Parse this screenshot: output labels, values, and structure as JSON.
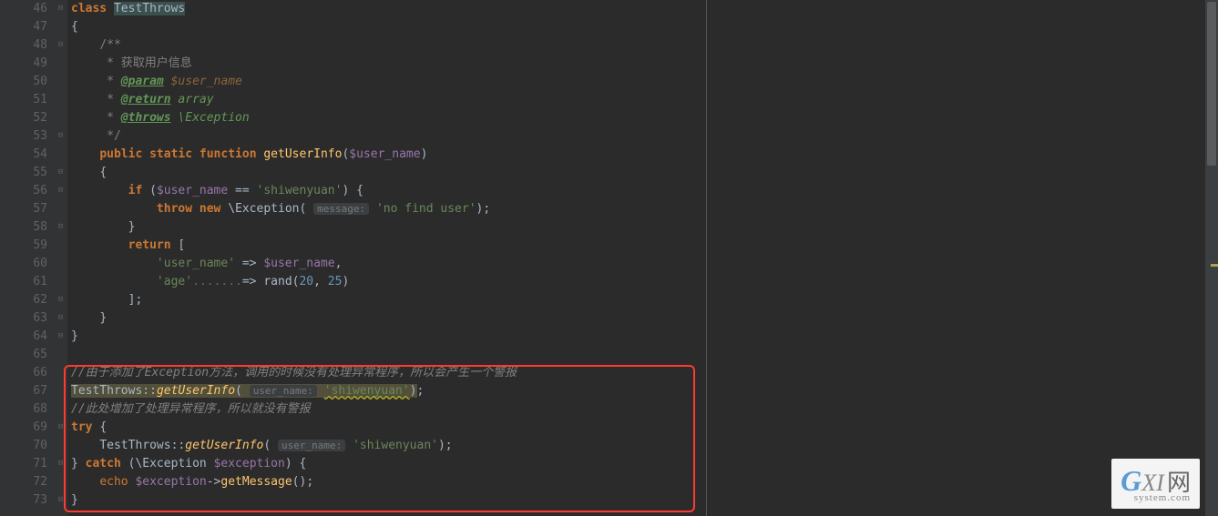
{
  "lines": {
    "start": 46,
    "end": 73
  },
  "code": {
    "l46_class": "class",
    "l46_name": "TestThrows",
    "l47_brace": "{",
    "l48_doc": "/**",
    "l49_doc": " * 获取用户信息",
    "l50_tag": "@param",
    "l50_var": "$user_name",
    "l51_tag": "@return",
    "l51_type": "array",
    "l52_tag": "@throws",
    "l52_type": "\\Exception",
    "l53_doc": " */",
    "l54_public": "public",
    "l54_static": "static",
    "l54_function": "function",
    "l54_fn": "getUserInfo",
    "l54_var": "$user_name",
    "l55_brace": "{",
    "l56_if": "if",
    "l56_var": "$user_name",
    "l56_eq": "==",
    "l56_str": "'shiwenyuan'",
    "l57_throw": "throw",
    "l57_new": "new",
    "l57_exc": "\\Exception",
    "l57_hint": "message:",
    "l57_str": "'no find user'",
    "l58_brace": "}",
    "l59_return": "return",
    "l60_key": "'user_name'",
    "l60_var": "$user_name",
    "l61_key": "'age'",
    "l61_dots": ".......",
    "l61_fn": "rand",
    "l61_n1": "20",
    "l61_n2": "25",
    "l62_bracket": "];",
    "l63_brace": "}",
    "l64_brace": "}",
    "l66_comment": "//由于添加了Exception方法，调用的时候没有处理异常程序，所以会产生一个警报",
    "l67_class": "TestThrows",
    "l67_fn": "getUserInfo",
    "l67_hint": "user_name:",
    "l67_str": "'shiwenyuan'",
    "l68_comment": "//此处增加了处理异常程序，所以就没有警报",
    "l69_try": "try",
    "l70_class": "TestThrows",
    "l70_fn": "getUserInfo",
    "l70_hint": "user_name:",
    "l70_str": "'shiwenyuan'",
    "l71_catch": "catch",
    "l71_exc": "\\Exception",
    "l71_var": "$exception",
    "l72_echo": "echo",
    "l72_var": "$exception",
    "l72_fn": "getMessage",
    "l73_brace": "}"
  },
  "watermark": {
    "g": "G",
    "xi": "XI",
    "wang": "网",
    "sub": "system.com"
  }
}
